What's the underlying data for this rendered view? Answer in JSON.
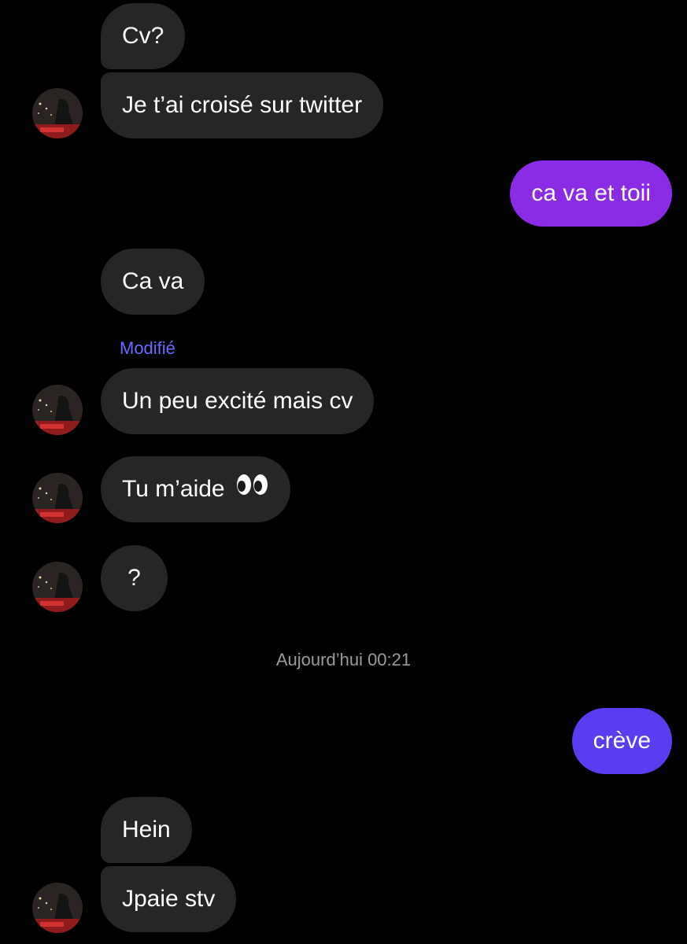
{
  "messages": [
    {
      "text": "Cv?"
    },
    {
      "text": "Je t’ai croisé sur twitter"
    },
    {
      "text": "ca va et toii"
    },
    {
      "text": "Ca va"
    },
    {
      "text": "Un peu excité mais cv"
    },
    {
      "text": "Tu m’aide",
      "emoji": "eyes-emoji"
    },
    {
      "text": "?"
    },
    {
      "text": "crève"
    },
    {
      "text": "Hein"
    },
    {
      "text": "Jpaie stv"
    }
  ],
  "edited_label": "Modifié",
  "timestamp": "Aujourd’hui 00:21",
  "colors": {
    "background": "#000000",
    "incoming_bubble": "#262626",
    "outgoing_bubble_1": "#8a2be6",
    "outgoing_bubble_2": "#5b3cf0",
    "edited_label": "#6b6bff",
    "timestamp": "#9a9a9a"
  },
  "icons": {
    "avatar": "profile-photo-avatar",
    "emoji": "eyes-emoji"
  }
}
